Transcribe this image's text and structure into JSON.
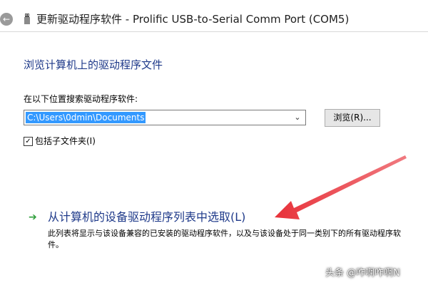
{
  "window": {
    "title": "更新驱动程序软件 - Prolific USB-to-Serial Comm Port (COM5)",
    "back_icon": "back-arrow-icon",
    "device_icon": "usb-device-icon"
  },
  "main": {
    "heading": "浏览计算机上的驱动程序文件",
    "search_label": "在以下位置搜索驱动程序软件:",
    "path_value": "C:\\Users\\0dmin\\Documents",
    "browse_label": "浏览(R)...",
    "include_subfolders_label": "包括子文件夹(I)",
    "include_subfolders_checked": true,
    "pick_link_title": "从计算机的设备驱动程序列表中选取(L)",
    "pick_link_desc": "此列表将显示与该设备兼容的已安装的驱动程序软件，以及与该设备处于同一类别下的所有驱动程序软件。"
  },
  "overlay": {
    "watermark": "头条 @咋啊咋啊N",
    "annotation_arrow_color": "#e8323a"
  },
  "colors": {
    "link": "#1f3a8a",
    "selection": "#3399ff",
    "go_arrow": "#2e9e3a"
  }
}
